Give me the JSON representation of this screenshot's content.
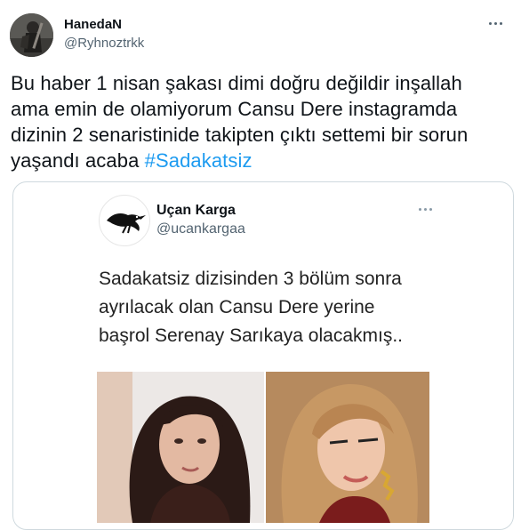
{
  "tweet": {
    "display_name": "HanedaN",
    "handle": "@Ryhnoztrkk",
    "text_lines": [
      "Bu haber 1 nisan şakası dimi doğru değildir inşallah",
      "ama emin de olamiyorum Cansu Dere instagramda",
      "dizinin 2 senaristinide takipten çıktı settemi bir sorun",
      "yaşandı acaba "
    ],
    "hashtag": "#Sadakatsiz"
  },
  "quoted_tweet": {
    "display_name": "Uçan Karga",
    "handle": "@ucankargaa",
    "text_lines": [
      "Sadakatsiz dizisinden 3 bölüm sonra",
      "ayrılacak olan Cansu Dere yerine",
      "başrol Serenay Sarıkaya olacakmış.."
    ]
  },
  "colors": {
    "accent": "#1d9bf0",
    "text": "#0f1419",
    "secondary": "#536471",
    "border": "#cfd9de"
  },
  "icons": {
    "more": "more-horizontal-icon",
    "crow_logo": "crow-logo-icon"
  }
}
